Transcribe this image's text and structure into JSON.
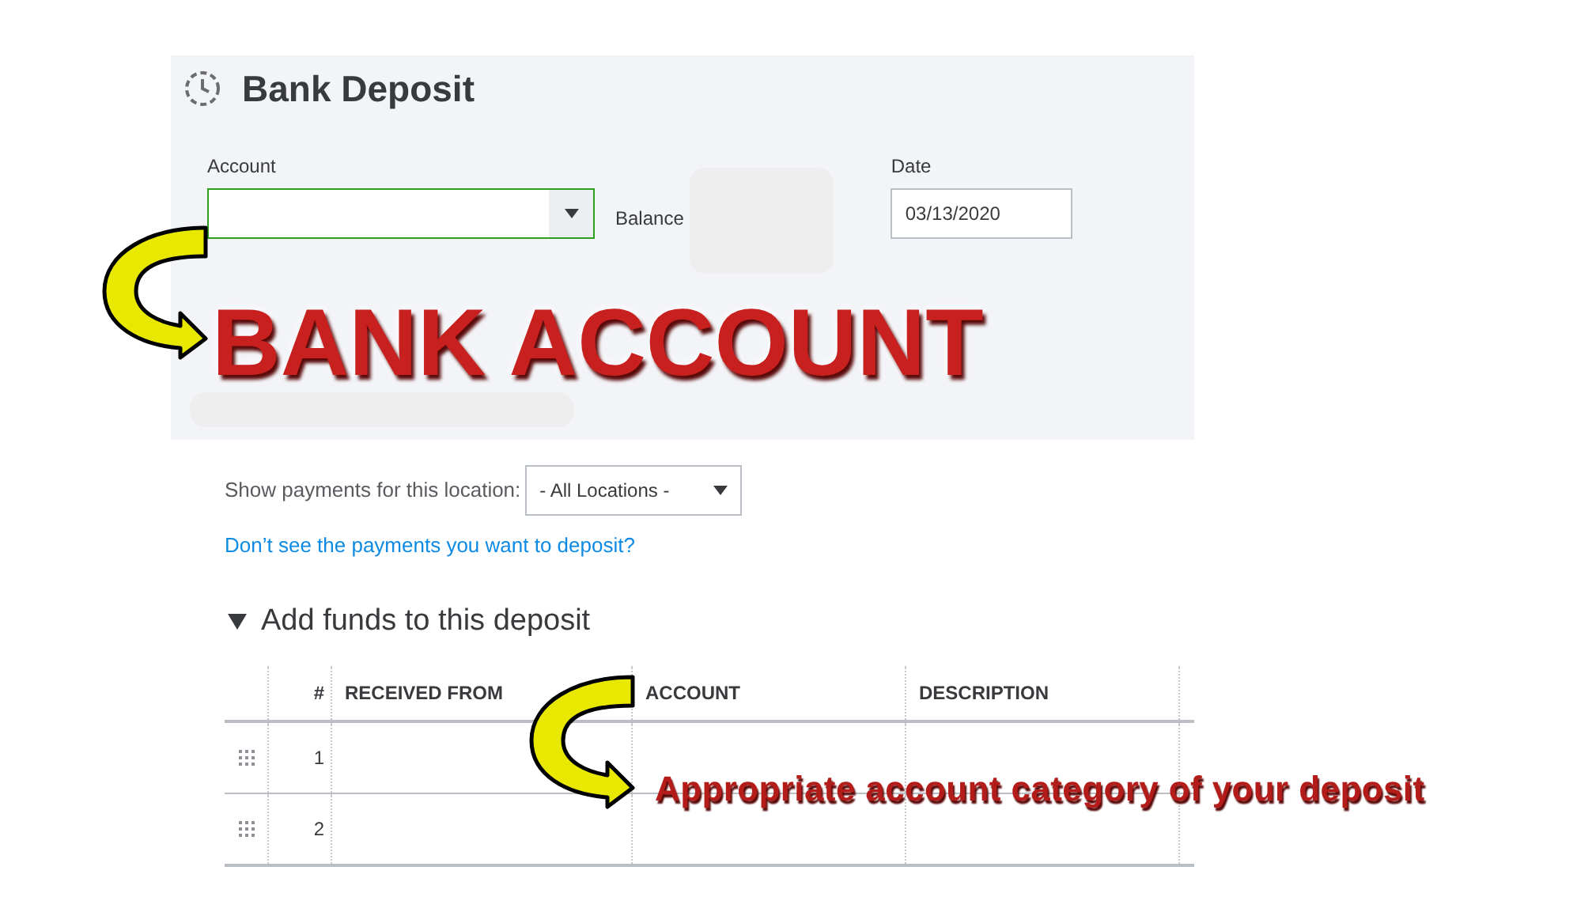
{
  "header": {
    "title": "Bank Deposit"
  },
  "account": {
    "label": "Account"
  },
  "balance": {
    "label": "Balance"
  },
  "date": {
    "label": "Date",
    "value": "03/13/2020"
  },
  "location": {
    "label": "Show payments for this location:",
    "value": "- All Locations -"
  },
  "help_link": "Don’t see the payments you want to deposit?",
  "section": {
    "title": "Add funds to this deposit",
    "expanded": true
  },
  "table": {
    "columns": [
      "#",
      "RECEIVED FROM",
      "ACCOUNT",
      "DESCRIPTION"
    ],
    "rows": [
      {
        "number": "1"
      },
      {
        "number": "2"
      }
    ]
  },
  "annotations": [
    {
      "kind": "banner",
      "text": "BANK ACCOUNT"
    },
    {
      "kind": "callout",
      "text": "Appropriate account category of your deposit"
    }
  ]
}
